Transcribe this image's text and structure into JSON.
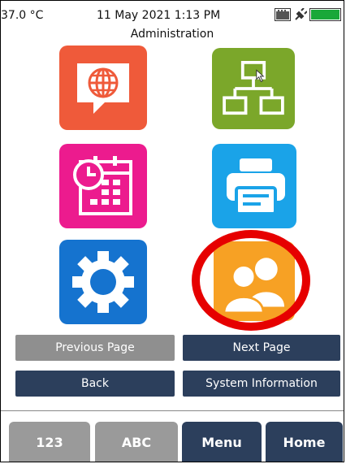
{
  "status": {
    "temperature": "37.0 °C",
    "datetime": "11 May 2021 1:13 PM",
    "title": "Administration"
  },
  "icons": [
    {
      "name": "network-settings",
      "icon": "globe-speech-icon",
      "color": "#ef5a3a"
    },
    {
      "name": "network-topology",
      "icon": "hierarchy-icon",
      "color": "#7ba72a"
    },
    {
      "name": "schedule",
      "icon": "calendar-clock-icon",
      "color": "#ec1b8e"
    },
    {
      "name": "printer",
      "icon": "printer-icon",
      "color": "#1aa3e8"
    },
    {
      "name": "settings",
      "icon": "gear-icon",
      "color": "#1573cf"
    },
    {
      "name": "users",
      "icon": "users-icon",
      "color": "#f7a124",
      "highlight": "#e60000"
    }
  ],
  "buttons": {
    "previous_page": "Previous Page",
    "next_page": "Next Page",
    "back": "Back",
    "system_information": "System Information"
  },
  "tabs": {
    "numeric": "123",
    "alpha": "ABC",
    "menu": "Menu",
    "home": "Home"
  }
}
